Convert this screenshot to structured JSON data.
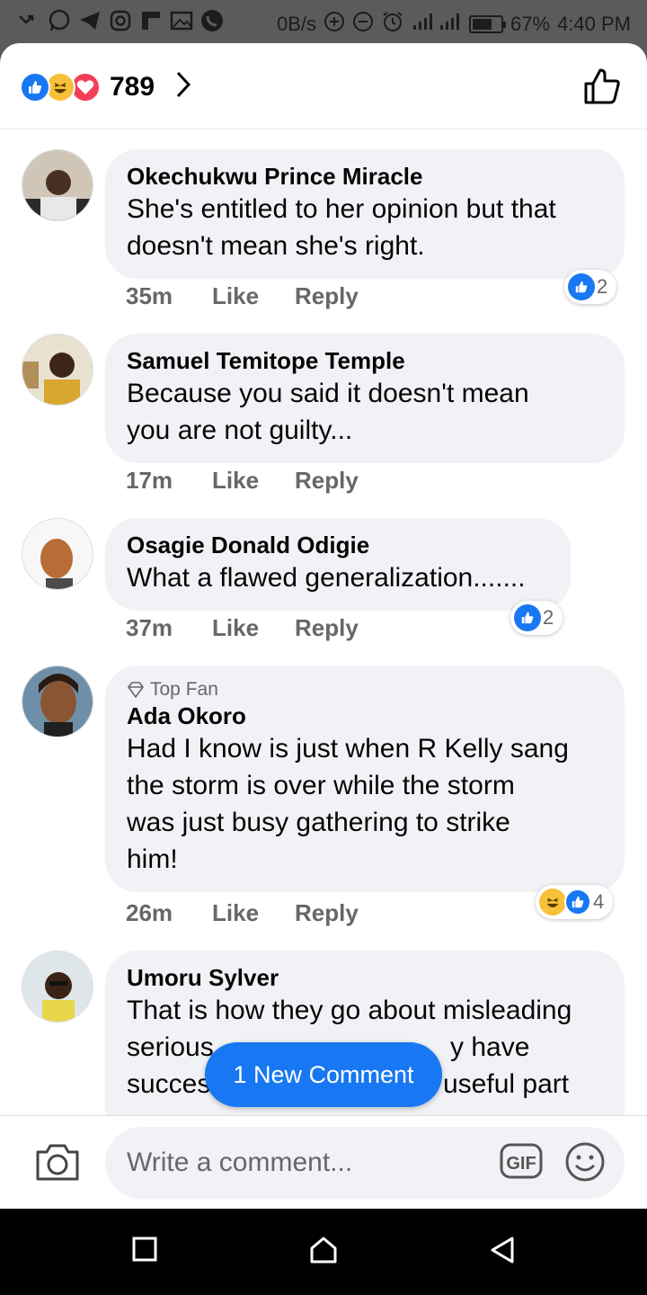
{
  "status_bar": {
    "net_speed": "0B/s",
    "battery": "67%",
    "time": "4:40 PM"
  },
  "header": {
    "reaction_count": "789"
  },
  "comments": [
    {
      "author": "Okechukwu Prince Miracle",
      "lines": [
        "She's entitled to her opinion but that",
        "doesn't mean she's right."
      ],
      "time": "35m",
      "like": "Like",
      "reply": "Reply",
      "reaction_count": "2"
    },
    {
      "author": "Samuel Temitope Temple",
      "lines": [
        "Because you said it doesn't mean",
        "you are not guilty..."
      ],
      "time": "17m",
      "like": "Like",
      "reply": "Reply"
    },
    {
      "author": "Osagie Donald Odigie",
      "lines": [
        "What a flawed generalization......."
      ],
      "time": "37m",
      "like": "Like",
      "reply": "Reply",
      "reaction_count": "2"
    },
    {
      "badge": "Top Fan",
      "author": "Ada Okoro",
      "lines": [
        "Had I know is just when R Kelly sang",
        "the storm is over while the storm",
        "was just  busy gathering to strike",
        "him!"
      ],
      "time": "26m",
      "like": "Like",
      "reply": "Reply",
      "reaction_count": "4"
    },
    {
      "author": "Umoru Sylver",
      "lines": [
        "That is how they go about misleading",
        "serious",
        "succes",
        "useful part"
      ],
      "line_right_1": "y have"
    }
  ],
  "new_comment_pill": "1 New Comment",
  "composer": {
    "placeholder": "Write a comment...",
    "gif_label": "GIF"
  },
  "colors": {
    "accent": "#1877f2",
    "bubble": "#f0f2f5",
    "meta": "#65676b"
  }
}
